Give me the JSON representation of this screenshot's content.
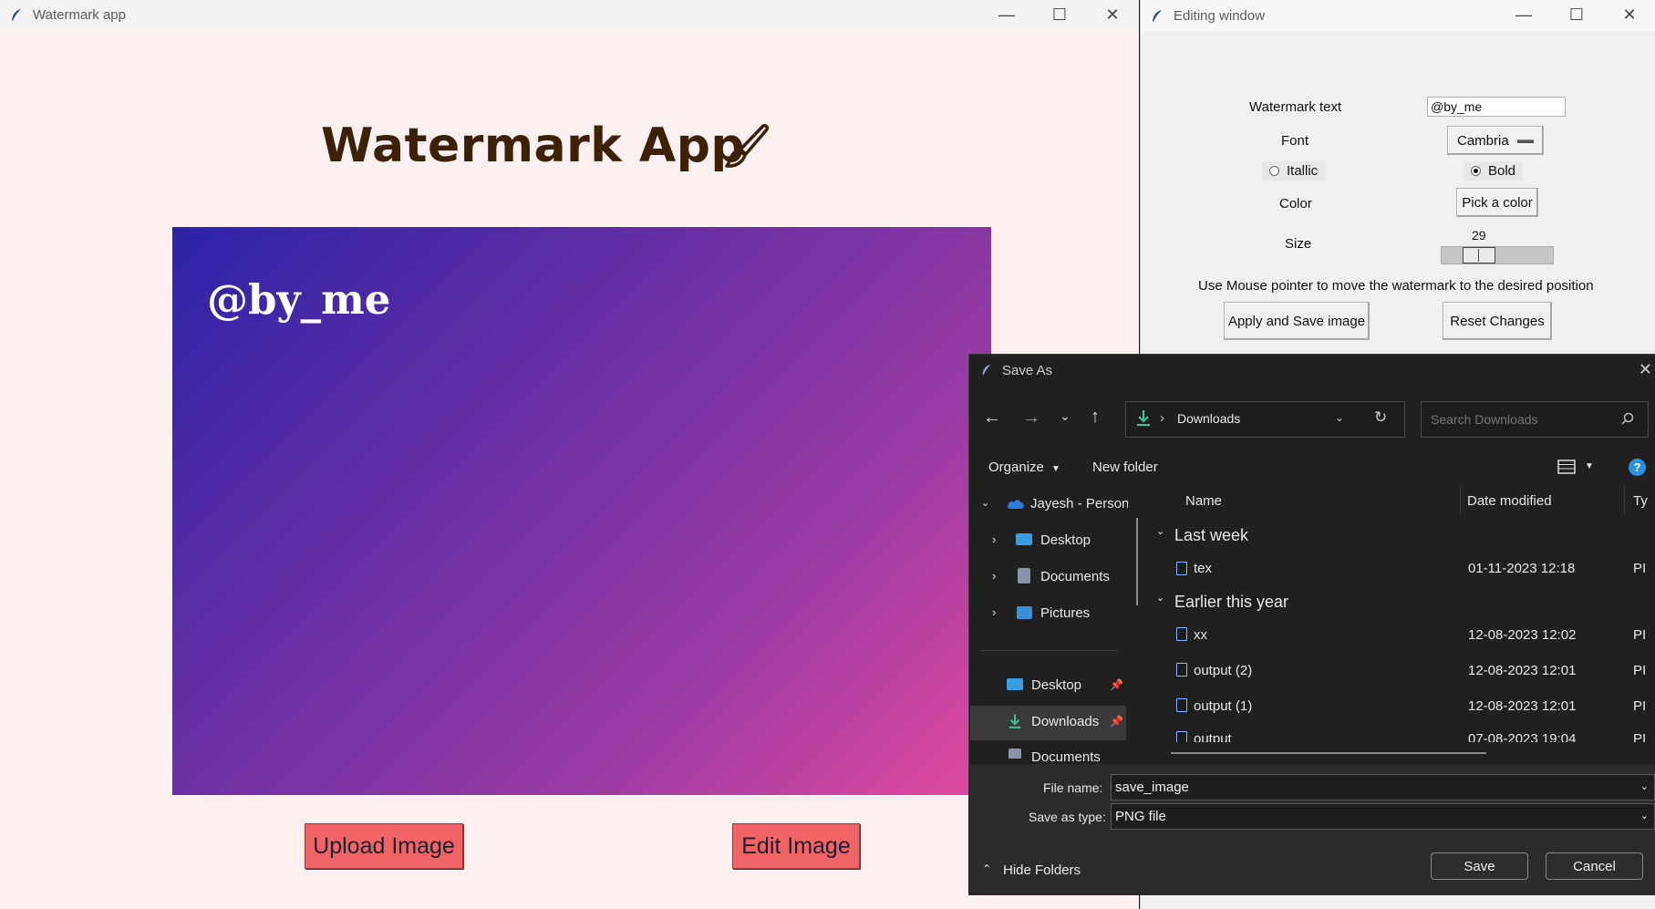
{
  "main_window": {
    "title": "Watermark app",
    "heading": "Watermark App",
    "watermark_preview": "@by_me",
    "upload_button": "Upload Image",
    "edit_button": "Edit Image"
  },
  "editing_window": {
    "title": "Editing window",
    "watermark_text_label": "Watermark text",
    "watermark_text_value": "@by_me",
    "font_label": "Font",
    "font_value": "Cambria",
    "italic_label": "Itallic",
    "italic_selected": false,
    "bold_label": "Bold",
    "bold_selected": true,
    "color_label": "Color",
    "pick_color_button": "Pick a color",
    "size_label": "Size",
    "size_value": "29",
    "instruction": "Use Mouse pointer to move the watermark to the desired position",
    "apply_button": "Apply and Save image",
    "reset_button": "Reset Changes"
  },
  "save_dialog": {
    "title": "Save As",
    "address_folder": "Downloads",
    "search_placeholder": "Search Downloads",
    "organize_label": "Organize",
    "new_folder_label": "New folder",
    "columns": {
      "name": "Name",
      "date_modified": "Date modified",
      "type": "Ty"
    },
    "nav_pane": {
      "account": "Jayesh - Persona",
      "tree_items": [
        "Desktop",
        "Documents",
        "Pictures"
      ],
      "quick_access": [
        "Desktop",
        "Downloads",
        "Documents"
      ]
    },
    "groups": [
      {
        "label": "Last week",
        "files": [
          {
            "name": "tex",
            "date": "01-11-2023 12:18",
            "type": "PI"
          }
        ]
      },
      {
        "label": "Earlier this year",
        "files": [
          {
            "name": "xx",
            "date": "12-08-2023 12:02",
            "type": "PI"
          },
          {
            "name": "output (2)",
            "date": "12-08-2023 12:01",
            "type": "PI"
          },
          {
            "name": "output (1)",
            "date": "12-08-2023 12:01",
            "type": "PI"
          },
          {
            "name": "output",
            "date": "07-08-2023 19:04",
            "type": "PI"
          }
        ]
      }
    ],
    "file_name_label": "File name:",
    "file_name_value": "save_image",
    "save_type_label": "Save as type:",
    "save_type_value": "PNG file",
    "hide_folders_label": "Hide Folders",
    "save_button": "Save",
    "cancel_button": "Cancel"
  },
  "colors": {
    "main_bg": "#fdf0f0",
    "heading": "#3c2107",
    "red_button": "#f06466",
    "dialog_bg": "#202020",
    "accent": "#2da8e0"
  }
}
